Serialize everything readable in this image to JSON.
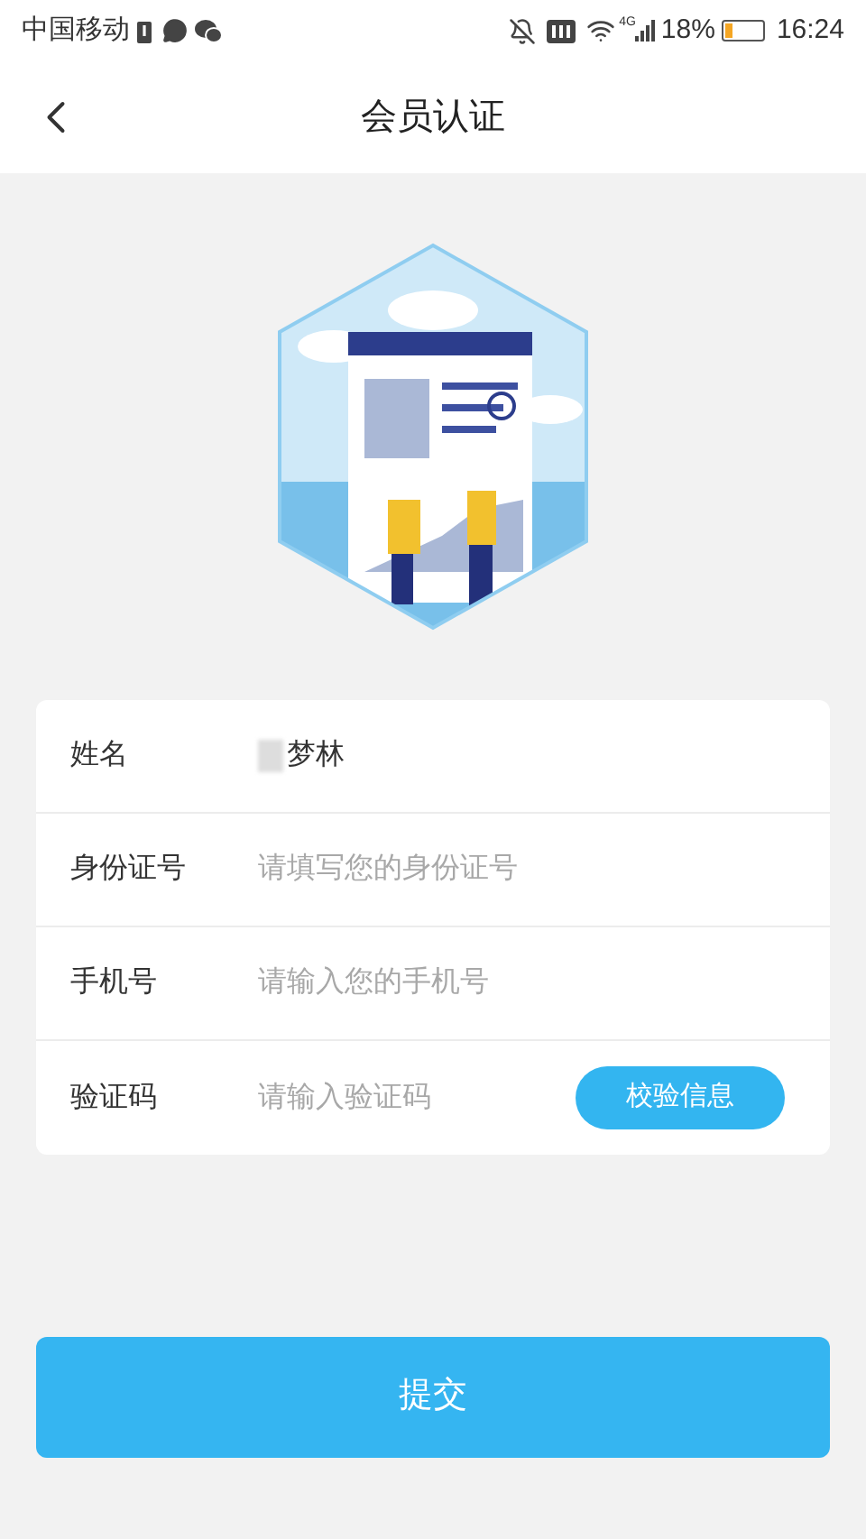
{
  "status_bar": {
    "carrier": "中国移动",
    "network": "4G",
    "battery": "18%",
    "time": "16:24"
  },
  "header": {
    "title": "会员认证"
  },
  "form": {
    "rows": [
      {
        "kind": "value",
        "label": "姓名",
        "value": "梦林",
        "redacted": true
      },
      {
        "kind": "input",
        "label": "身份证号",
        "placeholder": "请填写您的身份证号"
      },
      {
        "kind": "input",
        "label": "手机号",
        "placeholder": "请输入您的手机号"
      },
      {
        "kind": "code",
        "label": "验证码",
        "placeholder": "请输入验证码",
        "button": "校验信息"
      }
    ]
  },
  "submit": {
    "label": "提交"
  }
}
